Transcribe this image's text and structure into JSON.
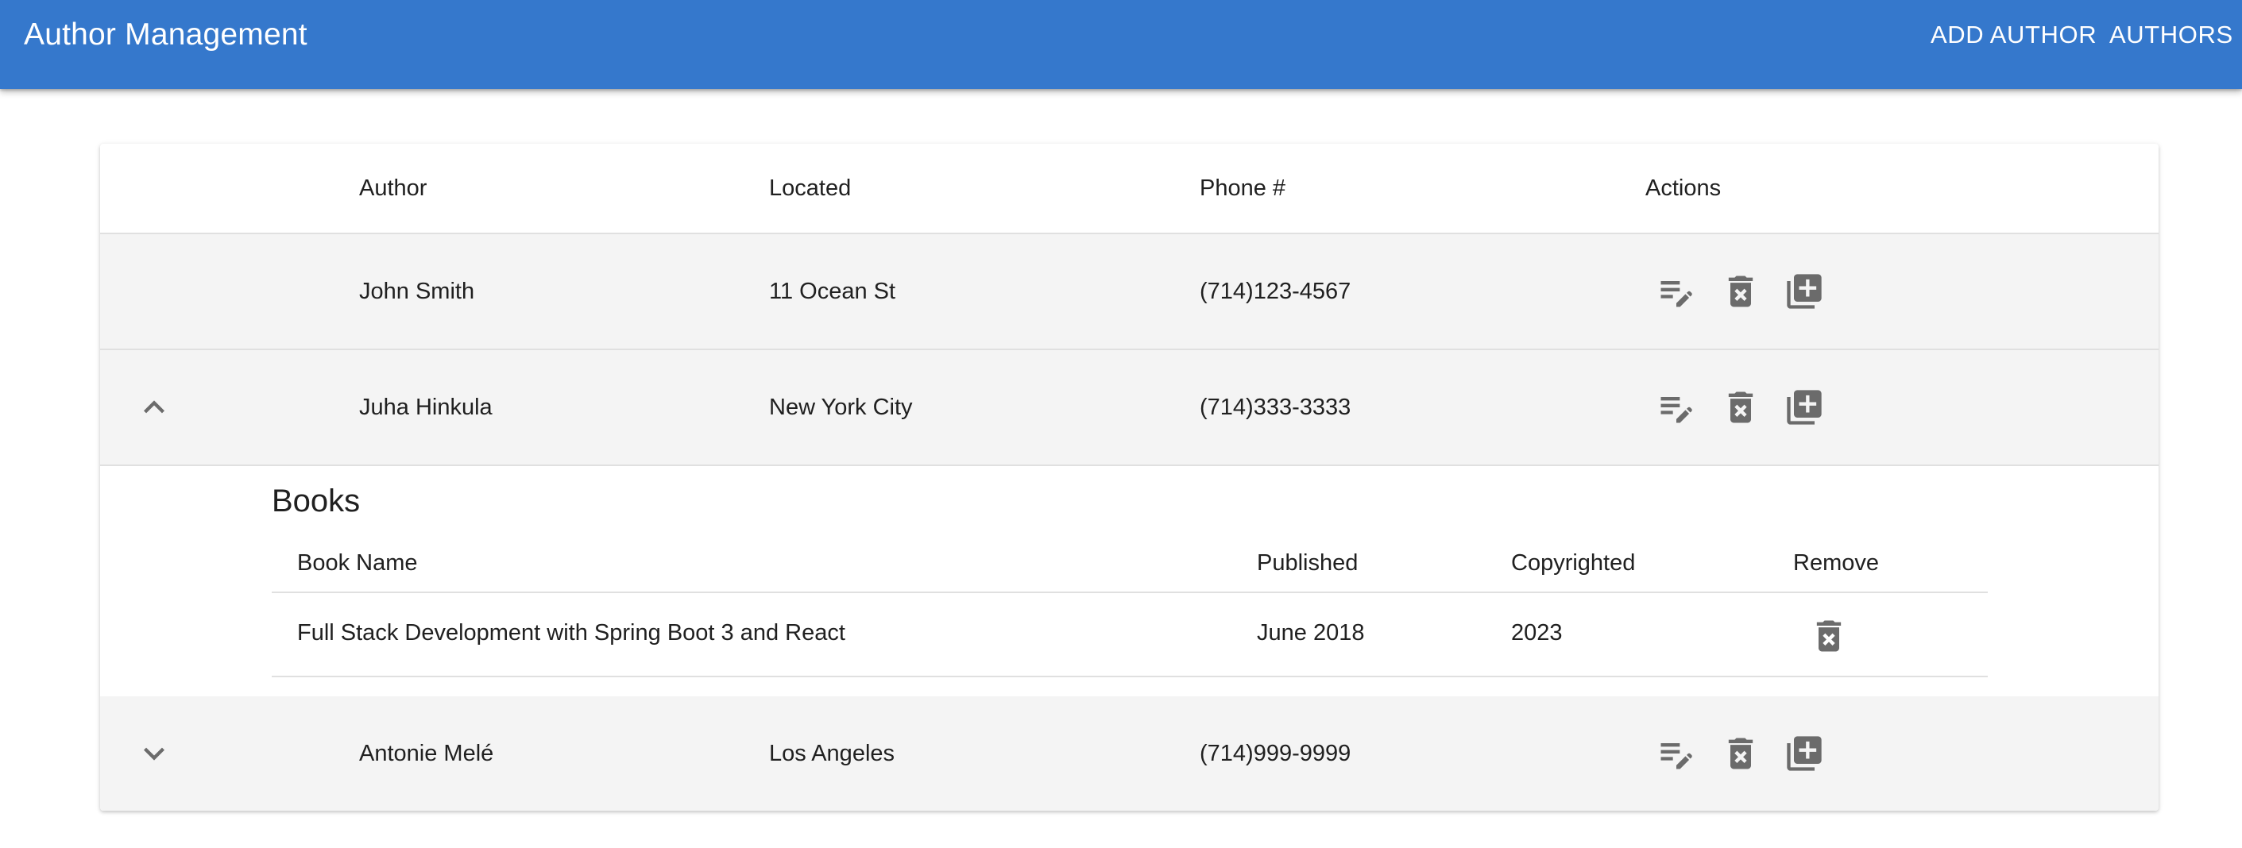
{
  "appbar": {
    "title": "Author Management",
    "nav": {
      "add_author": "ADD AUTHOR",
      "authors": "AUTHORS"
    },
    "color": "#3578cc"
  },
  "table": {
    "headers": {
      "author": "Author",
      "located": "Located",
      "phone": "Phone #",
      "actions": "Actions"
    },
    "rows": [
      {
        "author": "John Smith",
        "located": "11 Ocean St",
        "phone": "(714)123-4567",
        "expand_icon": "none"
      },
      {
        "author": "Juha Hinkula",
        "located": "New York City",
        "phone": "(714)333-3333",
        "expand_icon": "chevron-up-icon"
      },
      {
        "author": "Antonie Melé",
        "located": "Los Angeles",
        "phone": "(714)999-9999",
        "expand_icon": "chevron-down-icon"
      }
    ],
    "action_icons": [
      "edit-note-icon",
      "delete-icon",
      "add-book-icon"
    ],
    "row_background": "#f4f4f4"
  },
  "books": {
    "title": "Books",
    "headers": {
      "name": "Book Name",
      "published": "Published",
      "copyrighted": "Copyrighted",
      "remove": "Remove"
    },
    "rows": [
      {
        "name": "Full Stack Development with Spring Boot 3 and React",
        "published": "June 2018",
        "copyrighted": "2023"
      }
    ]
  },
  "icon_color": "#6b6b6b"
}
